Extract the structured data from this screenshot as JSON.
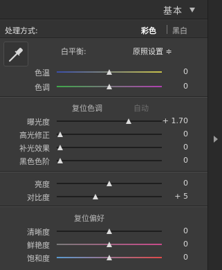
{
  "header": {
    "title": "基本"
  },
  "treatment": {
    "label": "处理方式:",
    "color": "彩色",
    "bw": "黑白"
  },
  "white_balance": {
    "label": "白平衡:",
    "value": "原照设置 ≑"
  },
  "tone_section": {
    "title": "复位色调",
    "auto": "自动"
  },
  "presence_section": {
    "title": "复位偏好"
  },
  "sliders": {
    "temp": {
      "label": "色温",
      "value": "0"
    },
    "tint": {
      "label": "色调",
      "value": "0"
    },
    "exposure": {
      "label": "曝光度",
      "value": "+ 1.70"
    },
    "recovery": {
      "label": "高光修正",
      "value": "0"
    },
    "fill": {
      "label": "补光效果",
      "value": "0"
    },
    "blacks": {
      "label": "黑色色阶",
      "value": "0"
    },
    "brightness": {
      "label": "亮度",
      "value": "0"
    },
    "contrast": {
      "label": "对比度",
      "value": "+ 5"
    },
    "clarity": {
      "label": "清晰度",
      "value": "0"
    },
    "vibrance": {
      "label": "鲜艳度",
      "value": "0"
    },
    "saturation": {
      "label": "饱和度",
      "value": "0"
    }
  },
  "colors": {
    "temp_gradient": [
      "#3a4ea8",
      "#c8c24a"
    ],
    "tint_gradient": [
      "#3fa84a",
      "#b040b0"
    ],
    "vibrance_gradient": [
      "#7a7a7a",
      "#c84a8a"
    ],
    "saturation_gradient": [
      "#888888",
      "#e04a4a"
    ]
  }
}
